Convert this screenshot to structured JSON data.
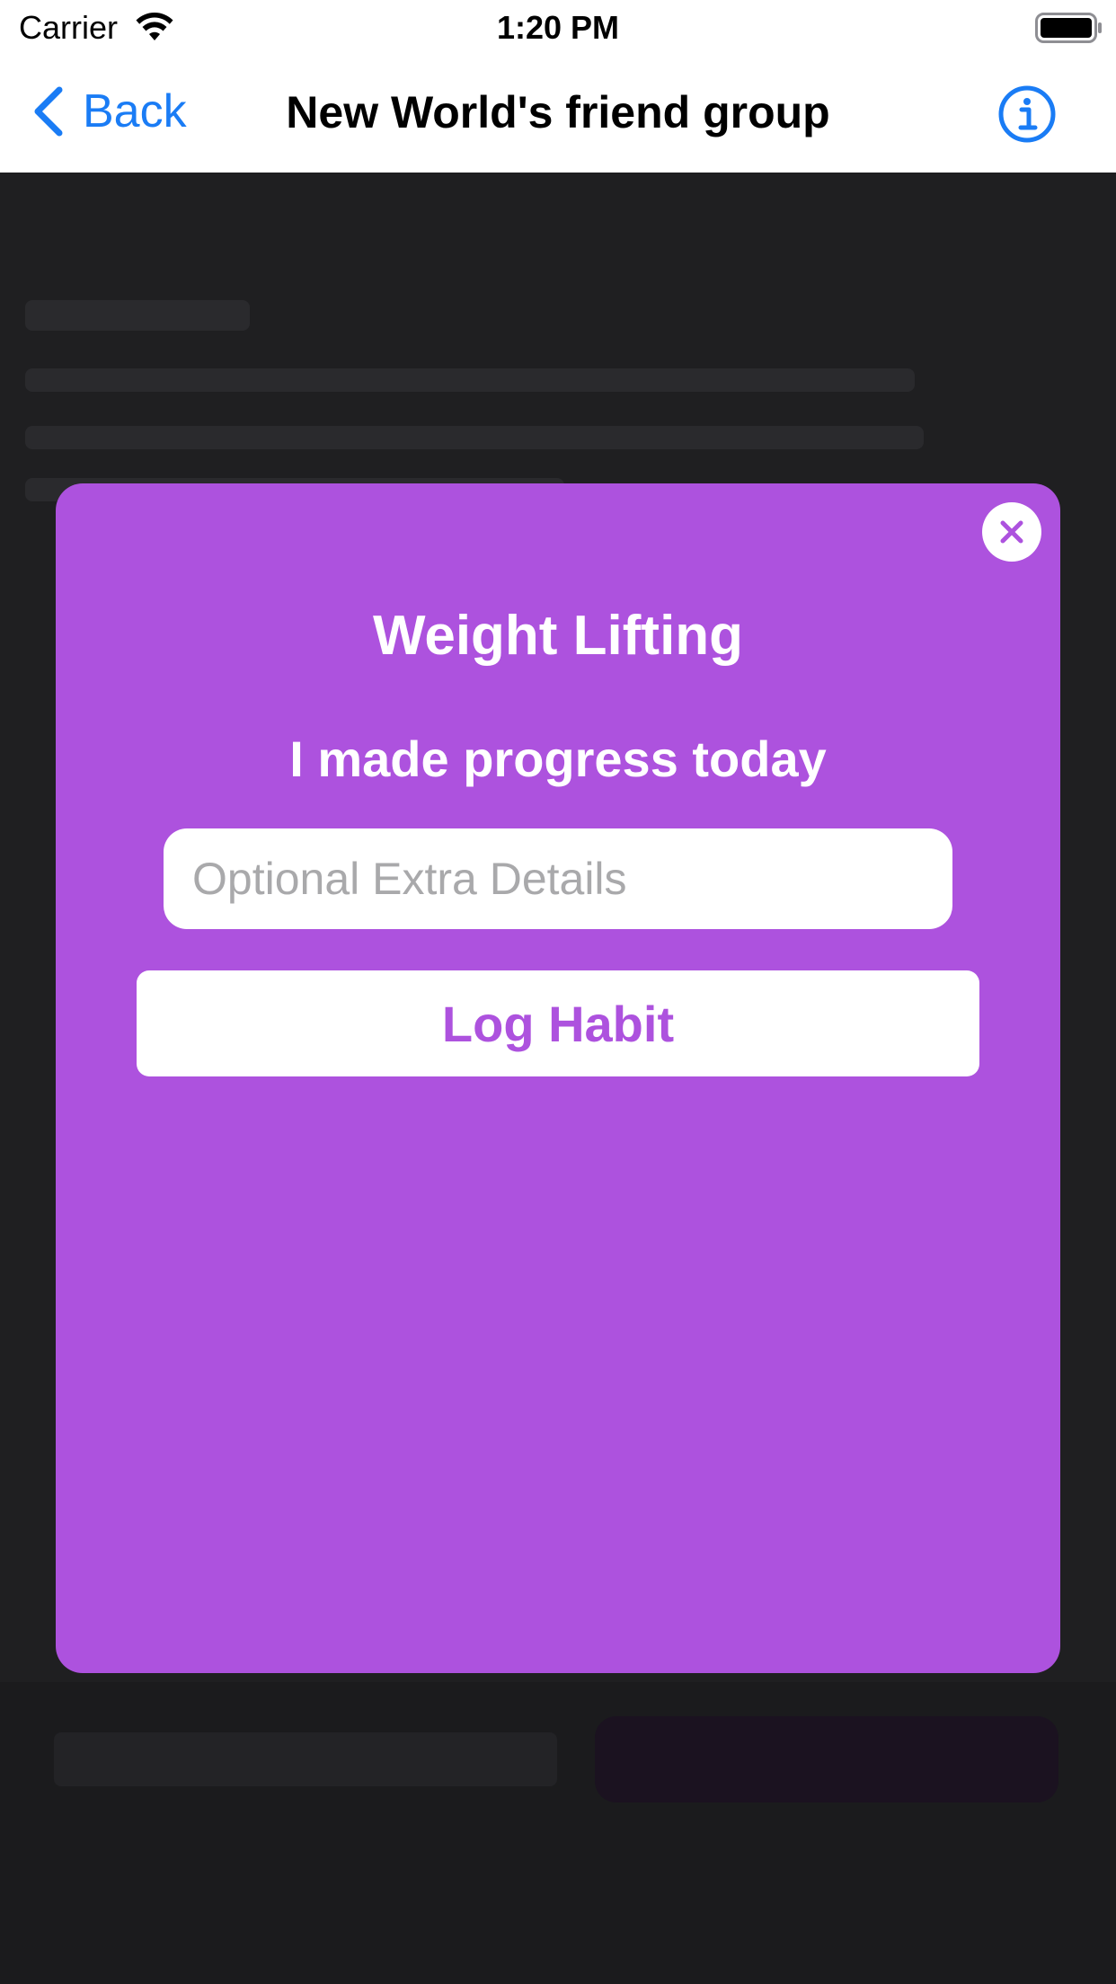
{
  "status_bar": {
    "carrier": "Carrier",
    "time": "1:20 PM"
  },
  "nav": {
    "back_label": "Back",
    "title": "New World's friend group"
  },
  "modal": {
    "title": "Weight Lifting",
    "subtitle": "I made progress today",
    "details_placeholder": "Optional Extra Details",
    "details_value": "",
    "log_button_label": "Log Habit"
  },
  "colors": {
    "accent": "#ad52de",
    "link_blue": "#1a7cf5",
    "overlay": "#1f1f21"
  },
  "icons": {
    "wifi": "wifi-icon",
    "battery": "battery-icon",
    "back": "chevron-left-icon",
    "info": "info-icon",
    "close": "close-icon"
  }
}
